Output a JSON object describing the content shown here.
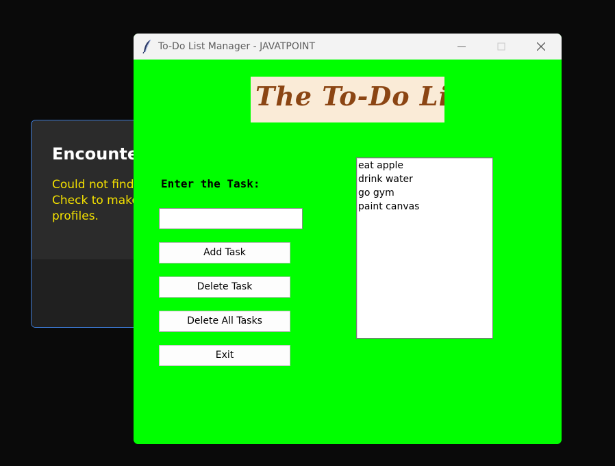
{
  "background_dialog": {
    "title": "Encountere",
    "message": "Could not find y\nCheck to make\nprofiles."
  },
  "window": {
    "title": "To-Do List Manager - JAVATPOINT",
    "app_icon": "feather-icon",
    "controls": {
      "minimize_icon": "minimize-icon",
      "maximize_icon": "maximize-icon",
      "close_icon": "close-icon"
    }
  },
  "app": {
    "banner_text": "The To-Do List",
    "task_label": "Enter the Task:",
    "task_input_value": "",
    "buttons": {
      "add": "Add Task",
      "delete": "Delete Task",
      "delete_all": "Delete All Tasks",
      "exit": "Exit"
    },
    "tasks": [
      "eat apple",
      "drink water",
      "go gym",
      "paint canvas"
    ]
  },
  "colors": {
    "window_bg": "#00ff00",
    "banner_bg": "#faebd7",
    "banner_text": "#8b4513",
    "dialog_message": "#f3e000",
    "dialog_border": "#3d7bd6"
  }
}
